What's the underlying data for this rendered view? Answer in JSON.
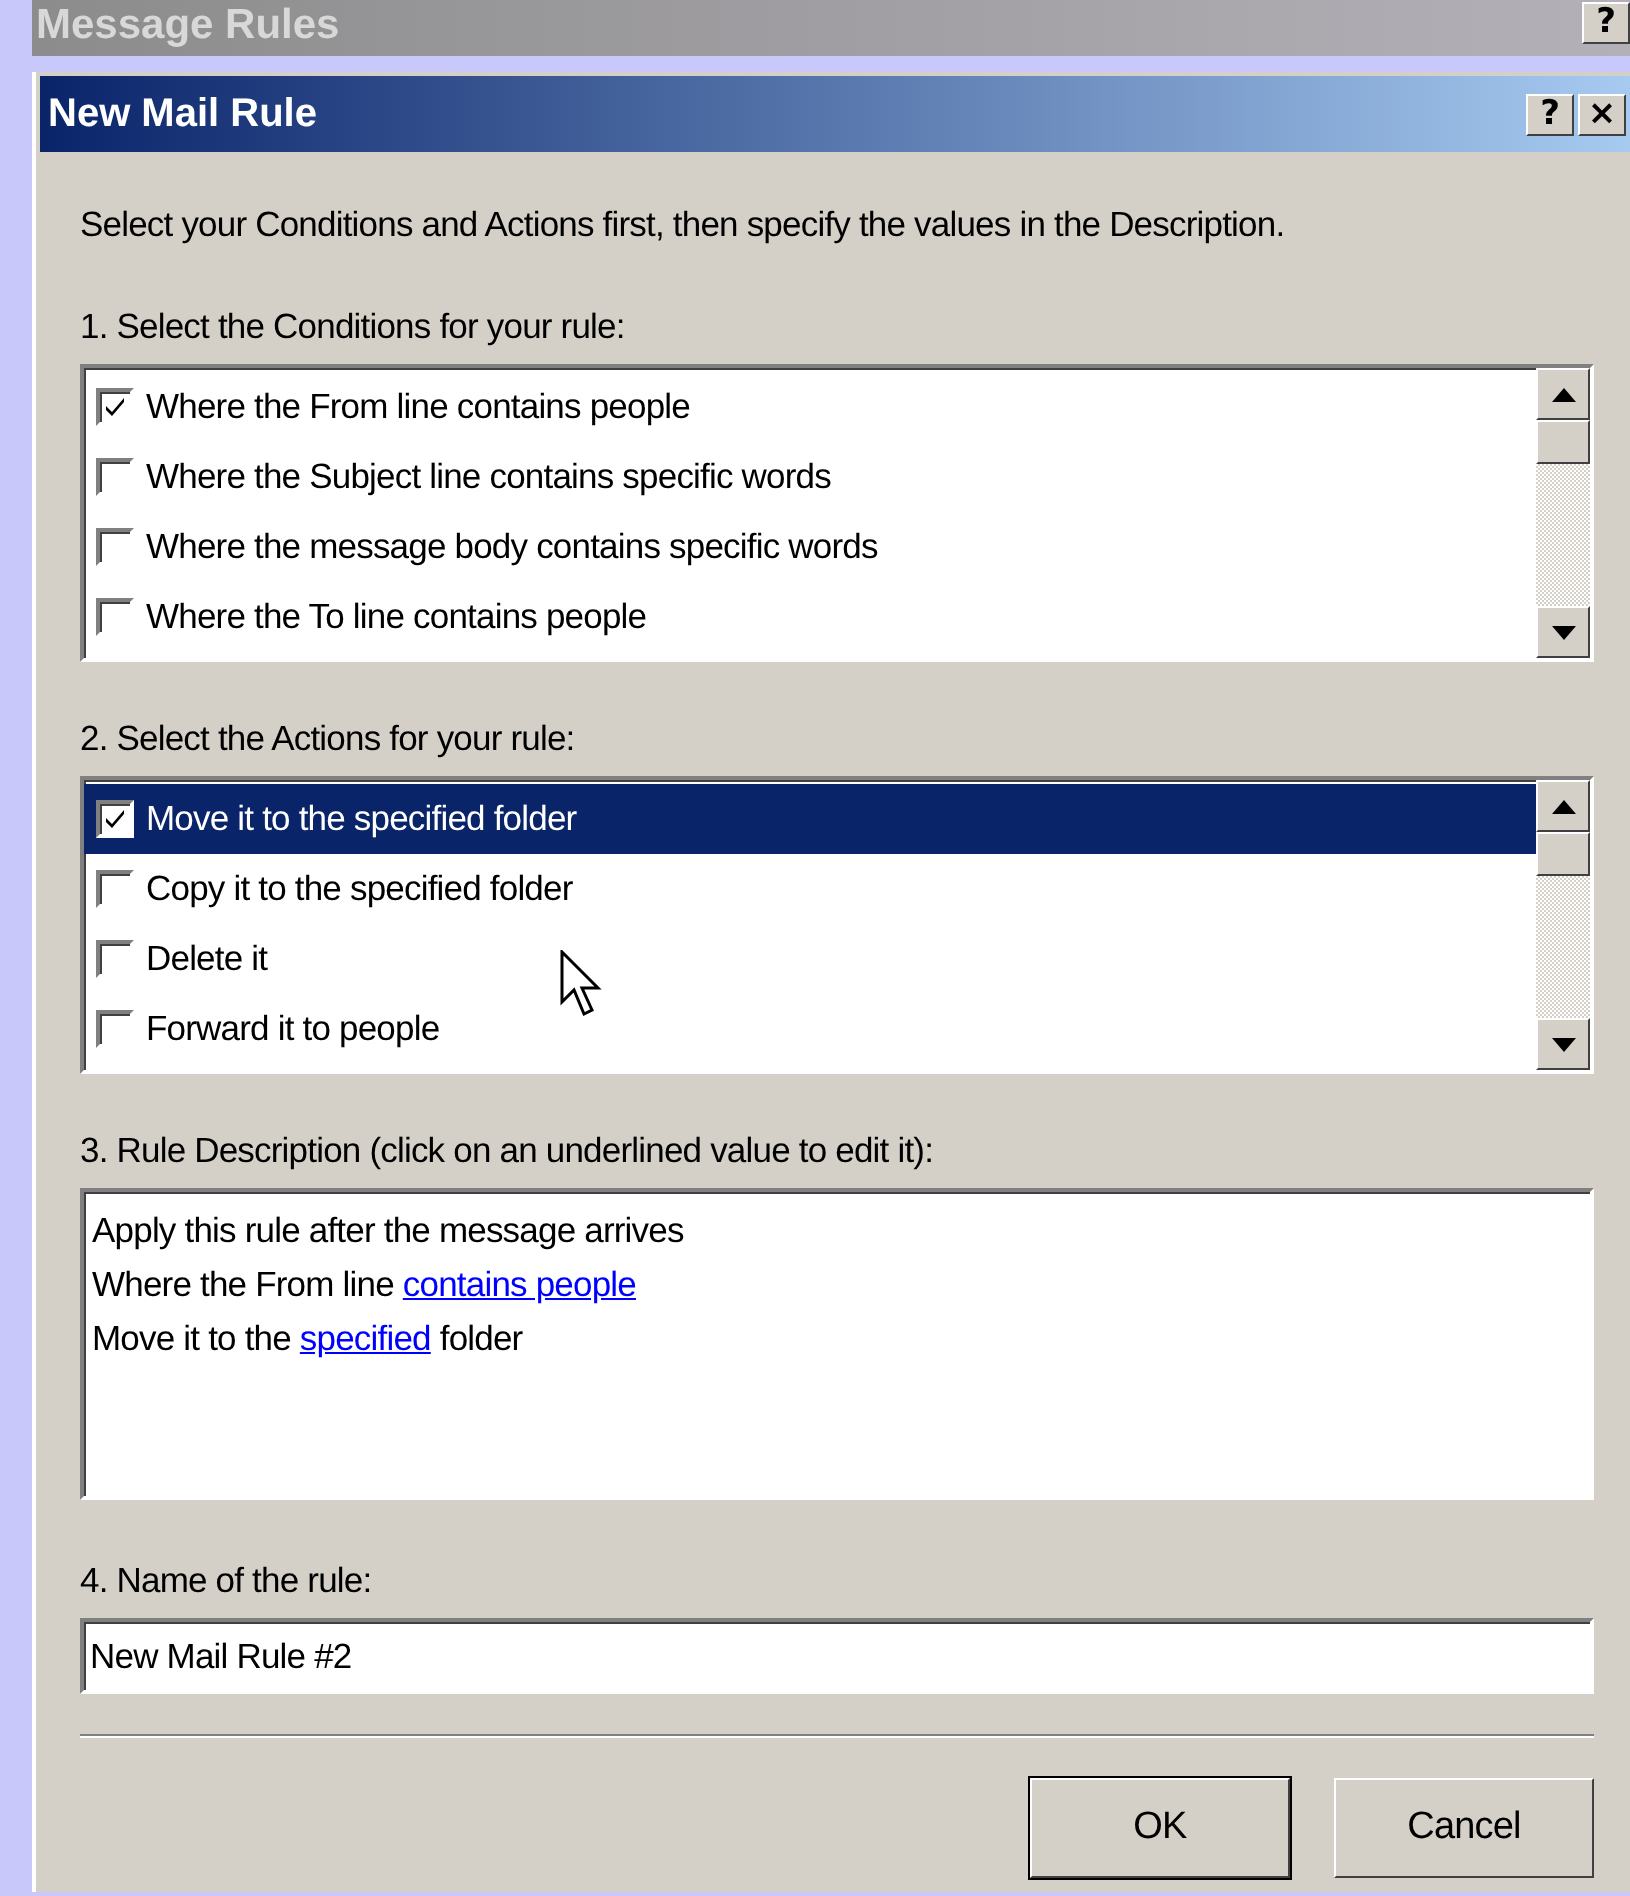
{
  "parent_window": {
    "title": "Message Rules",
    "buttons": [
      "?"
    ]
  },
  "window": {
    "title": "New Mail Rule",
    "buttons": [
      "?",
      "×"
    ]
  },
  "intro": "Select your Conditions and Actions first, then specify the values in the Description.",
  "conditions": {
    "label": "1. Select the Conditions for your rule:",
    "items": [
      {
        "label": "Where the From line contains people",
        "checked": true,
        "selected": false
      },
      {
        "label": "Where the Subject line contains specific words",
        "checked": false,
        "selected": false
      },
      {
        "label": "Where the message body contains specific words",
        "checked": false,
        "selected": false
      },
      {
        "label": "Where the To line contains people",
        "checked": false,
        "selected": false
      }
    ]
  },
  "actions": {
    "label": "2. Select the Actions for your rule:",
    "items": [
      {
        "label": "Move it to the specified folder",
        "checked": true,
        "selected": true
      },
      {
        "label": "Copy it to the specified folder",
        "checked": false,
        "selected": false
      },
      {
        "label": "Delete it",
        "checked": false,
        "selected": false
      },
      {
        "label": "Forward it to people",
        "checked": false,
        "selected": false
      }
    ]
  },
  "description": {
    "label": "3. Rule Description (click on an underlined value to edit it):",
    "lines": [
      [
        {
          "kind": "text",
          "text": "Apply this rule after the message arrives"
        }
      ],
      [
        {
          "kind": "text",
          "text": "Where the From line "
        },
        {
          "kind": "link",
          "text": "contains people"
        }
      ],
      [
        {
          "kind": "text",
          "text": "Move it to the "
        },
        {
          "kind": "link",
          "text": "specified"
        },
        {
          "kind": "text",
          "text": " folder"
        }
      ]
    ]
  },
  "name": {
    "label": "4. Name of the rule:",
    "value": "New Mail Rule #2"
  },
  "buttons": [
    "OK",
    "Cancel"
  ]
}
